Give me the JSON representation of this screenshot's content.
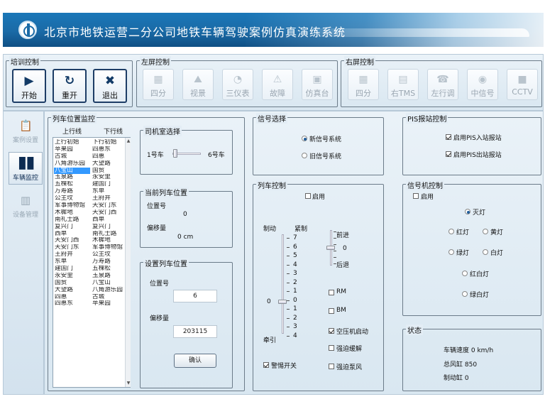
{
  "header": {
    "title": "北京市地铁运营二分公司地铁车辆驾驶案例仿真演练系统"
  },
  "training": {
    "legend": "培训控制",
    "buttons": [
      {
        "label": "开始",
        "icon": "play-icon"
      },
      {
        "label": "重开",
        "icon": "refresh-icon"
      },
      {
        "label": "退出",
        "icon": "close-icon"
      }
    ]
  },
  "left_screen": {
    "legend": "左屏控制",
    "buttons": [
      {
        "label": "四分",
        "icon": "quad-split-icon"
      },
      {
        "label": "视景",
        "icon": "scene-icon"
      },
      {
        "label": "三仪表",
        "icon": "gauge-icon"
      },
      {
        "label": "故障",
        "icon": "warning-icon"
      },
      {
        "label": "仿真台",
        "icon": "console-icon"
      }
    ]
  },
  "right_screen": {
    "legend": "右屏控制",
    "buttons": [
      {
        "label": "四分",
        "icon": "quad-split-icon"
      },
      {
        "label": "右TMS",
        "icon": "tms-icon"
      },
      {
        "label": "左行调",
        "icon": "phone-icon"
      },
      {
        "label": "中信号",
        "icon": "signal-icon"
      },
      {
        "label": "CCTV",
        "icon": "camera-icon"
      }
    ]
  },
  "nav": [
    {
      "label": "案例设置",
      "icon": "clipboard-icon",
      "active": false
    },
    {
      "label": "车辆监控",
      "icon": "book-icon",
      "active": true
    },
    {
      "label": "设备管理",
      "icon": "grid-icon",
      "active": false
    }
  ],
  "train_monitor": {
    "legend": "列车位置监控",
    "up_header": "上行线",
    "down_header": "下行线",
    "up_list": [
      "上行初始",
      "苹果园",
      "古城",
      "八角游乐园",
      "八宝山",
      "玉泉路",
      "五棵松",
      "万寿路",
      "公主坟",
      "军事博物馆",
      "木樨地",
      "南礼士路",
      "复兴门",
      "西单",
      "天安门西",
      "天安门东",
      "王府井",
      "东单",
      "建国门",
      "永安里",
      "国贸",
      "大望路",
      "四惠",
      "四惠东"
    ],
    "up_selected": 4,
    "down_list": [
      "下行初始",
      "四惠东",
      "四惠",
      "大望路",
      "国贸",
      "永安里",
      "建国门",
      "东单",
      "王府井",
      "天安门东",
      "天安门西",
      "西单",
      "复兴门",
      "南礼士路",
      "木樨地",
      "军事博物馆",
      "公主坟",
      "万寿路",
      "五棵松",
      "玉泉路",
      "八宝山",
      "八角游乐园",
      "古城",
      "苹果园"
    ]
  },
  "cab_select": {
    "legend": "司机室选择",
    "left": "1号车",
    "right": "6号车"
  },
  "current_pos": {
    "legend": "当前列车位置",
    "pos_label": "位置号",
    "pos_value": "0",
    "offset_label": "偏移量",
    "offset_value": "0 cm"
  },
  "set_pos": {
    "legend": "设置列车位置",
    "pos_label": "位置号",
    "pos_value": "6",
    "offset_label": "偏移量",
    "offset_value": "203115",
    "confirm": "确认"
  },
  "signal_select": {
    "legend": "信号选择",
    "options": [
      "新信号系统",
      "旧信号系统"
    ],
    "selected": 0
  },
  "train_control": {
    "legend": "列车控制",
    "enable": "启用",
    "brake": "制动",
    "emergency": "紧制",
    "traction": "牵引",
    "scale": [
      "7",
      "6",
      "5",
      "4",
      "3",
      "2",
      "1",
      "0",
      "1",
      "2",
      "3",
      "4"
    ],
    "zero": "0",
    "forward": "前进",
    "dir_zero": "0",
    "backward": "后退",
    "checks": [
      {
        "label": "RM",
        "checked": false
      },
      {
        "label": "BM",
        "checked": false
      },
      {
        "label": "空压机启动",
        "checked": true
      },
      {
        "label": "强迫缓解",
        "checked": false
      },
      {
        "label": "强迫泵风",
        "checked": false
      }
    ],
    "alert": {
      "label": "警惕开关",
      "checked": true
    }
  },
  "pis": {
    "legend": "PIS报站控制",
    "items": [
      {
        "label": "启用PIS入站报站",
        "checked": true
      },
      {
        "label": "启用PIS出站报站",
        "checked": true
      }
    ]
  },
  "signal_machine": {
    "legend": "信号机控制",
    "enable": "启用",
    "lights": [
      "灭灯",
      "红灯",
      "黄灯",
      "绿灯",
      "白灯",
      "红白灯",
      "绿白灯"
    ],
    "selected": 0
  },
  "status": {
    "legend": "状态",
    "speed": "车辆速度 0 km/h",
    "main_reservoir": "总风缸 850",
    "brake_cylinder": "制动缸 0"
  }
}
